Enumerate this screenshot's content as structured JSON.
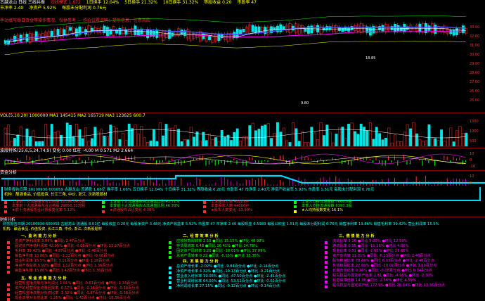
{
  "colors": {
    "bg": "#000000",
    "up": "#ff3030",
    "down": "#00e5e5",
    "accent": "#ffff00",
    "info": "#ff00ff",
    "cyan": "#00ffff",
    "green": "#00ff00"
  },
  "header": {
    "stock": "古越龙山 日线 三线共振",
    "line1": [
      "均线模式 1.672",
      "1日换手 12.04%",
      "5日换手 21.32%",
      "10日换手 31.32%",
      "等股收益 0.20",
      "市盈率 47",
      "市净率 2.40",
      "净资产 5.92%",
      "每股未分配利润 0.76元"
    ],
    "line2": "手动填写每日资金等操作情况，仅供参考 — 均价位置说明：提示信息，注意风险"
  },
  "main_chart": {
    "price_labels": [
      "33.00",
      "32.00",
      "31.00",
      "30.00",
      "29.00",
      "28.00",
      "27.00",
      "26.00",
      "25.00"
    ],
    "low_mark": "9.80",
    "high_mark": "18.85"
  },
  "vol_panel": {
    "title": "VOL(5,10,20) 1000000  MA1 145415  MA2 165719  MA3 123625  600.7",
    "labels": [
      "1500",
      "1000",
      "500"
    ]
  },
  "osc_panel": {
    "title": "波段特殊(25,6,5,24,74,9)  变化 0.00  红柱 -4.00  M 0.571  M2 2.664",
    "labels": [
      "10",
      "0",
      "-10"
    ]
  },
  "flow_panel": {
    "title": "资金分析",
    "labels": [
      "10",
      "0"
    ]
  },
  "info_strip": {
    "l1": "财务报告日期:20100930  600059 古越龙山  流通股 1.66亿  换手率 1.66%  五日换手 12.04%  十日换手 31.32%  等股收益 0.20元  市盈率 47  市净率 2.40元  净资产收益率 5.92%  市盈率 1.51元  每股未分配利润 0.76元",
    "l2": "机构：酿酒食品, 价值投资, 长江三角, 中价, 浙江, 次新股题材",
    "items": [
      {
        "text": "上季前十大流通股东合计持股 28396.84万股",
        "color": "#ff3030"
      },
      {
        "text": "上季前十大流通股东占流通盘比例 43.71%",
        "color": "#00ff00"
      },
      {
        "text": "上季股东人数 48889户",
        "color": "#ff3030"
      },
      {
        "text": "上季人均持流通股数 7008.0股",
        "color": "#00ff00"
      },
      {
        "text": "本季前十大流通股东合计持股 29850.31万股",
        "color": "#ff3030"
      },
      {
        "text": "本季前十大流通股东占流通盘比例 46.70%",
        "color": "#00ff00"
      },
      {
        "text": "本季股东人数 44000户",
        "color": "#ff3030"
      },
      {
        "text": "本季人均持流通股数 8193.3股",
        "color": "#00ff00"
      },
      {
        "text": "★前十流通股东合计持股变化率 5.12%",
        "color": "#ff3030"
      },
      {
        "text": "★流通股东占比变化 4.38%",
        "color": "#ff3030"
      },
      {
        "text": "★股东人数变化 -13.99%",
        "color": "#ff3030"
      },
      {
        "text": "★人均持股数变化 16.1%",
        "color": "#ffff00"
      }
    ]
  },
  "fin_panel": {
    "title": "财务分析",
    "hdr1": "财务报告日期:20100930  600059 古越龙山  流通股 8.01亿  每股收益 0.20元  每股净资产 3.48元  净资产收益率 5.92%  市盈率 47  市净率 2.40  每股现金 6.5983  每股公积金 1.51元  每股未分配利润 0.76元  销售净利率 13.86%  销售毛利率 39.42%  营业利润率 15.5%",
    "hdr2": "机构：酿酒食品, 价值投资, 长江三角, 中价, 浙江, 次新股题材",
    "sections": [
      {
        "title": "一、盈 利 能 力 分 析",
        "items": [
          "总资产净利润率 3.04%  ●同比 2.47百分点",
          "固定资产净值利润率 42.95%  ●同比 -0.06百分点  ●环比 13.37百分点",
          "毛利率 39.42%  ●同比 -4.87百分点  ●环比 -0.40百分点",
          "销售净利率 13.86%  ●同比 -2.22百分点  ●环比 -0.06百分点",
          "营业利润率 15.5%  ●同比 3.11百分点  ●环比 1.18百分点",
          "净资产收益率 5.92%  ●同比 1.12百分点  ●环比 1.36百分点",
          "销售净利率 13.86%  ●同比 1.42百分点  ●环比 1.36百分点"
        ]
      },
      {
        "title": "二、经 营 效 率 分 析",
        "items": [
          "应收帐款周转率 2.53  ●同比 15.15%  ●环比 48.98%",
          "存货周转率 0.48  ●同比 16.41%  ●环比 24.78%",
          "固定资产周转率 1.20  ●同比 -18.01%  ●环比 37.09%",
          "总资产周转率 0.22  ●同比 -6.15%  ●环比 35.35%"
        ]
      },
      {
        "title": "三、偿 债 能 力 分 析",
        "items": [
          "流动比率 3.16  ●同比 5.00%  ●环比 12.59%",
          "速动比率 0.55  ●同比 -11.16%  ●环比 4.06%",
          "现金比率 0.51  ●同比 -2.65%  ●环比 21.66%",
          "资产负债率 21.31%  ●同比 -6.13百分点  ●环比 2.46百分点",
          "股东权益比率 78.69%  ●同比 6.13百分点  ●环比 -2.46百分点",
          "负债权益比率 27.09%  ●同比 -10.02百分点  ●环比 3.69百分点",
          "长期负债比率 0.26%  ●同比 -0.08百分点  ●环比 0.14百分点",
          "股东权益与固定资产比率 2.81  ●同比 -4.95%  ●环比 -2.30%",
          "利息保障倍数 14.38  ●同比 -2.56%  ●环比 4.59%",
          "股东权益与固定资产比 177.9%  ●同比 28.14%  ●环比 13.36百分点"
        ]
      },
      {
        "title": "四、发 展 能 力 分 析",
        "items": [
          "总资产增长率 -2.02%  ●同比 -9.84百分点  ●环比 -0.14百分点",
          "净资产增长率 4.32%  ●同比 -19.13百分点  ●环比 -0.21百分点",
          "营业收入增长率 19.06%  ●同比 -47.50百分点  ●环比 -2.41百分点",
          "营业利润增长率 64.00%  ●同比 -53.52百分点  ●环比 -0.02百分点",
          "净利润增长率 27.15%  ●同比 -0.12百分点  ●环比 -0.14百分点"
        ]
      },
      {
        "title": "五、现 金 流 量 能 力 分 析",
        "items": [
          "经营现金净流量与净利润比 1.01%  ●同比 -0.61百分点  ●环比 -1.34百分点",
          "资产的经营现金流量回报率 -0.57%  ●同比 -0.28百分点  ●环比 -0.38百分点",
          "经营现金净流量对负债比率 -1.32%  ●同比 -0.87百分点  ●环比 -0.38百分点",
          "现金流量对负债比率 -1.25%  ●同比 -1.42百分点  ●环比 -16.36百分点"
        ]
      }
    ]
  }
}
